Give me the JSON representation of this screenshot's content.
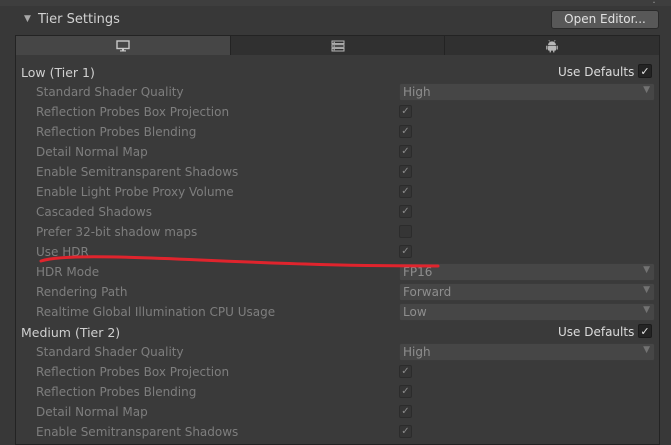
{
  "section": {
    "title": "Tier Settings",
    "open_editor_label": "Open Editor..."
  },
  "tabs": [
    {
      "icon": "monitor-icon",
      "selected": true
    },
    {
      "icon": "server-icon",
      "selected": false
    },
    {
      "icon": "android-icon",
      "selected": false
    }
  ],
  "use_defaults_label": "Use Defaults",
  "tiers": [
    {
      "name": "Low (Tier 1)",
      "use_defaults": true,
      "settings": [
        {
          "label": "Standard Shader Quality",
          "type": "dropdown",
          "value": "High"
        },
        {
          "label": "Reflection Probes Box Projection",
          "type": "checkbox",
          "checked": true
        },
        {
          "label": "Reflection Probes Blending",
          "type": "checkbox",
          "checked": true
        },
        {
          "label": "Detail Normal Map",
          "type": "checkbox",
          "checked": true
        },
        {
          "label": "Enable Semitransparent Shadows",
          "type": "checkbox",
          "checked": true
        },
        {
          "label": "Enable Light Probe Proxy Volume",
          "type": "checkbox",
          "checked": true
        },
        {
          "label": "Cascaded Shadows",
          "type": "checkbox",
          "checked": true
        },
        {
          "label": "Prefer 32-bit shadow maps",
          "type": "checkbox",
          "checked": false
        },
        {
          "label": "Use HDR",
          "type": "checkbox",
          "checked": true
        },
        {
          "label": "HDR Mode",
          "type": "dropdown",
          "value": "FP16"
        },
        {
          "label": "Rendering Path",
          "type": "dropdown",
          "value": "Forward"
        },
        {
          "label": "Realtime Global Illumination CPU Usage",
          "type": "dropdown",
          "value": "Low"
        }
      ]
    },
    {
      "name": "Medium (Tier 2)",
      "use_defaults": true,
      "settings": [
        {
          "label": "Standard Shader Quality",
          "type": "dropdown",
          "value": "High"
        },
        {
          "label": "Reflection Probes Box Projection",
          "type": "checkbox",
          "checked": true
        },
        {
          "label": "Reflection Probes Blending",
          "type": "checkbox",
          "checked": true
        },
        {
          "label": "Detail Normal Map",
          "type": "checkbox",
          "checked": true
        },
        {
          "label": "Enable Semitransparent Shadows",
          "type": "checkbox",
          "checked": true
        }
      ]
    }
  ],
  "colors": {
    "background": "#383838",
    "annotation": "#e0242d"
  }
}
